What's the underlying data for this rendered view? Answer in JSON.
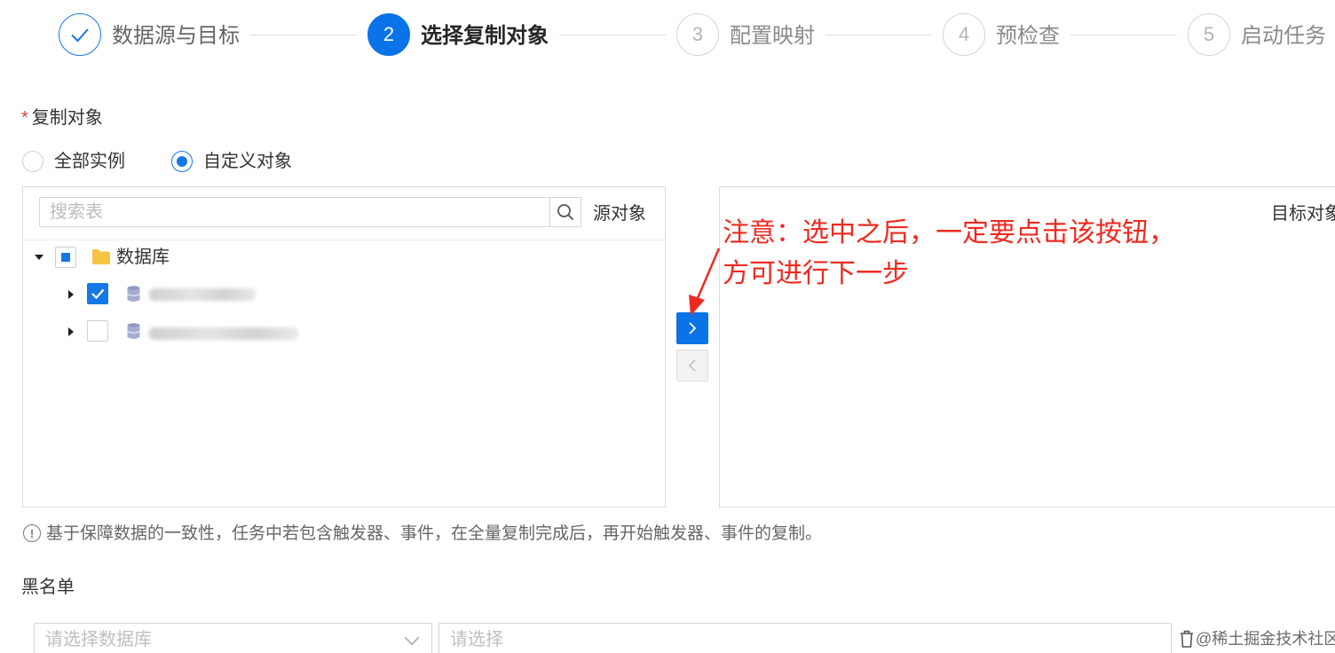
{
  "steps": [
    {
      "number": "",
      "label": "数据源与目标",
      "state": "done"
    },
    {
      "number": "2",
      "label": "选择复制对象",
      "state": "active"
    },
    {
      "number": "3",
      "label": "配置映射",
      "state": "pending"
    },
    {
      "number": "4",
      "label": "预检查",
      "state": "pending"
    },
    {
      "number": "5",
      "label": "启动任务",
      "state": "pending"
    }
  ],
  "copy_objects": {
    "required_mark": "*",
    "label": "复制对象",
    "options": [
      {
        "label": "全部实例",
        "selected": false
      },
      {
        "label": "自定义对象",
        "selected": true
      }
    ]
  },
  "source_panel": {
    "search_placeholder": "搜索表",
    "title": "源对象",
    "tree": {
      "root_label": "数据库",
      "root_expanded": true,
      "root_check": "indeterminate",
      "children": [
        {
          "checked": true,
          "expanded": false
        },
        {
          "checked": false,
          "expanded": false
        }
      ]
    }
  },
  "target_panel": {
    "title": "目标对象"
  },
  "transfer": {
    "to_right_glyph": ">",
    "to_left_glyph": "<"
  },
  "annotation": {
    "line1": "注意：选中之后，一定要点击该按钮，",
    "line2": "方可进行下一步"
  },
  "tip": {
    "icon": "!",
    "text": "基于保障数据的一致性，任务中若包含触发器、事件，在全量复制完成后，再开始触发器、事件的复制。"
  },
  "blacklist": {
    "label": "黑名单",
    "db_placeholder": "请选择数据库",
    "table_placeholder": "请选择"
  },
  "watermark": "@稀土掘金技术社区",
  "colors": {
    "primary": "#0a73e8",
    "annotation": "#ee2a20",
    "required": "#e0413e"
  }
}
